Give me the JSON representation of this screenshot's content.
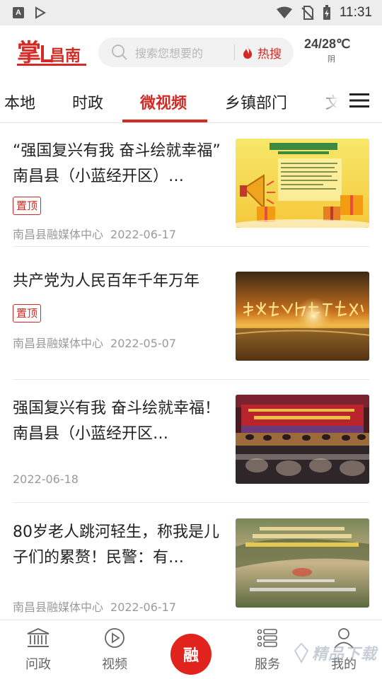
{
  "status_bar": {
    "time": "11:31",
    "left_icons": [
      "accessibility-a-icon",
      "play-store-icon"
    ],
    "right_icons": [
      "wifi-icon",
      "no-sim-icon",
      "battery-charging-icon"
    ]
  },
  "header": {
    "logo_text": "掌上昌南",
    "search_placeholder": "搜索您想要的",
    "hot_search_label": "热搜",
    "weather": {
      "temp": "24/28℃",
      "condition": "阴"
    }
  },
  "tabs": [
    {
      "label": "本地",
      "active": false
    },
    {
      "label": "时政",
      "active": false
    },
    {
      "label": "微视频",
      "active": true
    },
    {
      "label": "乡镇部门",
      "active": false
    },
    {
      "label": "文",
      "active": false
    }
  ],
  "feed": [
    {
      "title": "“强国复兴有我 奋斗绘就幸福” 南昌县（小蓝经开区）…",
      "badge": "置顶",
      "source": "南昌县融媒体中心",
      "date": "2022-06-17",
      "thumb": "announcement-poster"
    },
    {
      "title": "共产党为人民百年千年万年",
      "badge": "置顶",
      "source": "南昌县融媒体中心",
      "date": "2022-05-07",
      "thumb": "sunset-calligraphy"
    },
    {
      "title": "强国复兴有我 奋斗绘就幸福！南昌县（小蓝经开区…",
      "badge": "",
      "source": "",
      "date": "2022-06-18",
      "thumb": "stage-event"
    },
    {
      "title": "80岁老人跳河轻生，称我是儿子们的累赘！民警：有…",
      "badge": "",
      "source": "南昌县融媒体中心",
      "date": "2022-06-17",
      "thumb": "river-video"
    }
  ],
  "bottom_nav": {
    "items": [
      {
        "label": "问政",
        "icon": "government-building-icon"
      },
      {
        "label": "视频",
        "icon": "play-circle-icon"
      },
      {
        "label": "融",
        "icon": "center-rong-button"
      },
      {
        "label": "服务",
        "icon": "service-list-icon"
      },
      {
        "label": "我的",
        "icon": "person-icon"
      }
    ],
    "watermark": "精品下载"
  },
  "colors": {
    "brand_red": "#d42a25",
    "text": "#222222",
    "muted": "#9a9a9a"
  }
}
